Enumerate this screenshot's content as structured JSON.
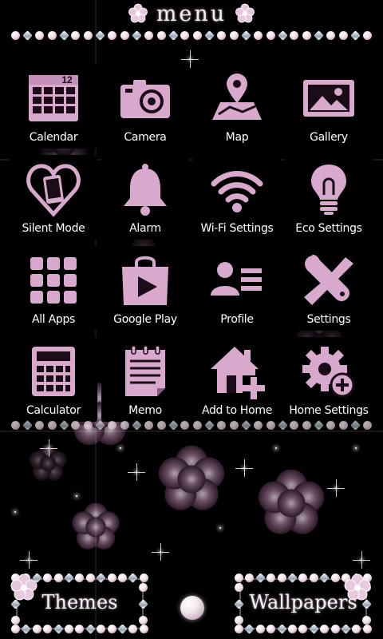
{
  "header": {
    "title": "menu"
  },
  "apps": [
    {
      "label": "Calendar",
      "icon": "calendar-icon",
      "badge": "12"
    },
    {
      "label": "Camera",
      "icon": "camera-icon"
    },
    {
      "label": "Map",
      "icon": "map-icon"
    },
    {
      "label": "Gallery",
      "icon": "gallery-icon"
    },
    {
      "label": "Silent Mode",
      "icon": "silent-mode-icon"
    },
    {
      "label": "Alarm",
      "icon": "alarm-bell-icon"
    },
    {
      "label": "Wi-Fi Settings",
      "icon": "wifi-icon"
    },
    {
      "label": "Eco Settings",
      "icon": "lightbulb-icon"
    },
    {
      "label": "All Apps",
      "icon": "app-grid-icon"
    },
    {
      "label": "Google Play",
      "icon": "play-store-icon"
    },
    {
      "label": "Profile",
      "icon": "profile-card-icon"
    },
    {
      "label": "Settings",
      "icon": "tools-icon"
    },
    {
      "label": "Calculator",
      "icon": "calculator-icon"
    },
    {
      "label": "Memo",
      "icon": "notepad-icon"
    },
    {
      "label": "Add to Home",
      "icon": "add-home-icon"
    },
    {
      "label": "Home Settings",
      "icon": "gear-icon"
    }
  ],
  "footer": {
    "themes_label": "Themes",
    "wallpapers_label": "Wallpapers"
  },
  "colors": {
    "accent": "#d8a9cc",
    "accent_dark": "#8f5a86",
    "background": "#000000",
    "label": "#ffffff"
  }
}
